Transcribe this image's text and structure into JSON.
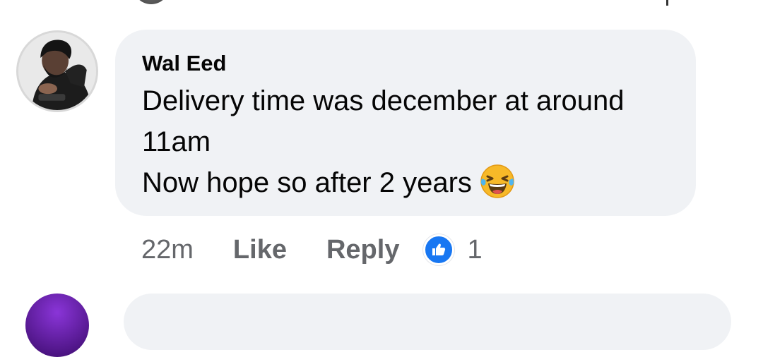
{
  "comment": {
    "author": "Wal Eed",
    "lines": [
      "Delivery time was december at around",
      "11am",
      "Now hope so after 2 years"
    ],
    "emoji": "laughing-tears-emoji"
  },
  "actions": {
    "timestamp": "22m",
    "like_label": "Like",
    "reply_label": "Reply",
    "reaction_icon": "thumbs-up-icon",
    "reaction_count": "1"
  },
  "colors": {
    "bubble": "#f0f2f5",
    "secondary_text": "#65676b",
    "primary_text": "#050505",
    "like_blue": "#1877f2"
  }
}
